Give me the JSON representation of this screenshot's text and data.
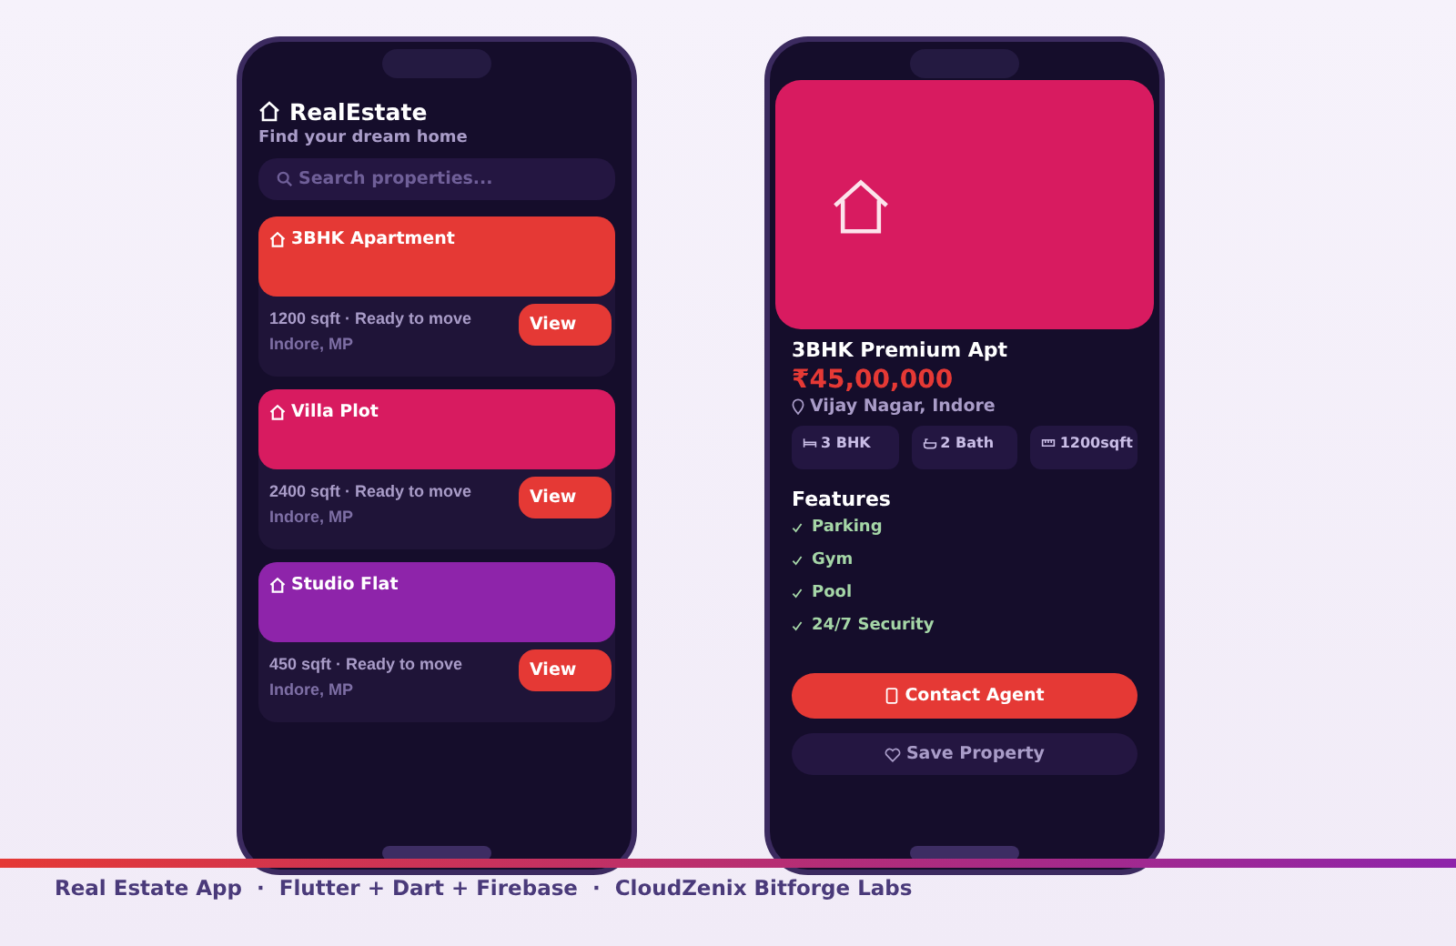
{
  "app": {
    "title": "RealEstate",
    "subtitle": "Find your dream home"
  },
  "search": {
    "placeholder": "Search properties..."
  },
  "listings": [
    {
      "title": "3BHK Apartment",
      "color": "#e53935",
      "meta": "1200 sqft · Ready to move",
      "location": "Indore, MP",
      "button": "View"
    },
    {
      "title": "Villa Plot",
      "color": "#d81b60",
      "meta": "2400 sqft · Ready to move",
      "location": "Indore, MP",
      "button": "View"
    },
    {
      "title": "Studio Flat",
      "color": "#8e24aa",
      "meta": "450 sqft · Ready to move",
      "location": "Indore, MP",
      "button": "View"
    }
  ],
  "detail": {
    "title": "3BHK Premium Apt",
    "price": "₹45,00,000",
    "location": "Vijay Nagar, Indore",
    "specs": [
      {
        "kind": "bed",
        "label": "3 BHK"
      },
      {
        "kind": "bath",
        "label": "2 Bath"
      },
      {
        "kind": "area",
        "label": "1200sqft"
      }
    ],
    "features_heading": "Features",
    "features": [
      "Parking",
      "Gym",
      "Pool",
      "24/7 Security"
    ],
    "buttons": [
      {
        "kind": "primary",
        "label": "Contact Agent"
      },
      {
        "kind": "secondary",
        "label": "Save Property"
      }
    ]
  },
  "footer": "Real Estate App  ·  Flutter + Dart + Firebase  ·  CloudZenix Bitforge Labs"
}
